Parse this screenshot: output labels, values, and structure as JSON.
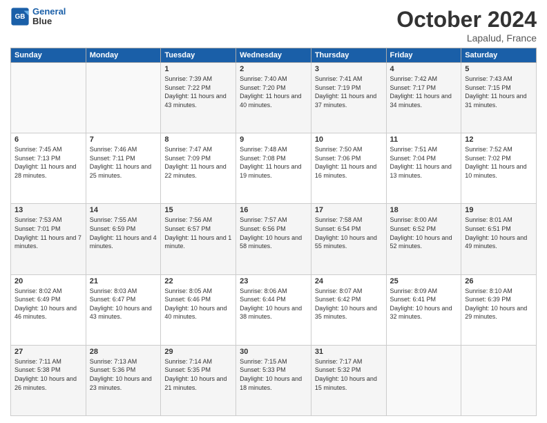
{
  "header": {
    "logo_line1": "General",
    "logo_line2": "Blue",
    "month": "October 2024",
    "location": "Lapalud, France"
  },
  "days_of_week": [
    "Sunday",
    "Monday",
    "Tuesday",
    "Wednesday",
    "Thursday",
    "Friday",
    "Saturday"
  ],
  "weeks": [
    [
      {
        "day": "",
        "sunrise": "",
        "sunset": "",
        "daylight": ""
      },
      {
        "day": "",
        "sunrise": "",
        "sunset": "",
        "daylight": ""
      },
      {
        "day": "1",
        "sunrise": "Sunrise: 7:39 AM",
        "sunset": "Sunset: 7:22 PM",
        "daylight": "Daylight: 11 hours and 43 minutes."
      },
      {
        "day": "2",
        "sunrise": "Sunrise: 7:40 AM",
        "sunset": "Sunset: 7:20 PM",
        "daylight": "Daylight: 11 hours and 40 minutes."
      },
      {
        "day": "3",
        "sunrise": "Sunrise: 7:41 AM",
        "sunset": "Sunset: 7:19 PM",
        "daylight": "Daylight: 11 hours and 37 minutes."
      },
      {
        "day": "4",
        "sunrise": "Sunrise: 7:42 AM",
        "sunset": "Sunset: 7:17 PM",
        "daylight": "Daylight: 11 hours and 34 minutes."
      },
      {
        "day": "5",
        "sunrise": "Sunrise: 7:43 AM",
        "sunset": "Sunset: 7:15 PM",
        "daylight": "Daylight: 11 hours and 31 minutes."
      }
    ],
    [
      {
        "day": "6",
        "sunrise": "Sunrise: 7:45 AM",
        "sunset": "Sunset: 7:13 PM",
        "daylight": "Daylight: 11 hours and 28 minutes."
      },
      {
        "day": "7",
        "sunrise": "Sunrise: 7:46 AM",
        "sunset": "Sunset: 7:11 PM",
        "daylight": "Daylight: 11 hours and 25 minutes."
      },
      {
        "day": "8",
        "sunrise": "Sunrise: 7:47 AM",
        "sunset": "Sunset: 7:09 PM",
        "daylight": "Daylight: 11 hours and 22 minutes."
      },
      {
        "day": "9",
        "sunrise": "Sunrise: 7:48 AM",
        "sunset": "Sunset: 7:08 PM",
        "daylight": "Daylight: 11 hours and 19 minutes."
      },
      {
        "day": "10",
        "sunrise": "Sunrise: 7:50 AM",
        "sunset": "Sunset: 7:06 PM",
        "daylight": "Daylight: 11 hours and 16 minutes."
      },
      {
        "day": "11",
        "sunrise": "Sunrise: 7:51 AM",
        "sunset": "Sunset: 7:04 PM",
        "daylight": "Daylight: 11 hours and 13 minutes."
      },
      {
        "day": "12",
        "sunrise": "Sunrise: 7:52 AM",
        "sunset": "Sunset: 7:02 PM",
        "daylight": "Daylight: 11 hours and 10 minutes."
      }
    ],
    [
      {
        "day": "13",
        "sunrise": "Sunrise: 7:53 AM",
        "sunset": "Sunset: 7:01 PM",
        "daylight": "Daylight: 11 hours and 7 minutes."
      },
      {
        "day": "14",
        "sunrise": "Sunrise: 7:55 AM",
        "sunset": "Sunset: 6:59 PM",
        "daylight": "Daylight: 11 hours and 4 minutes."
      },
      {
        "day": "15",
        "sunrise": "Sunrise: 7:56 AM",
        "sunset": "Sunset: 6:57 PM",
        "daylight": "Daylight: 11 hours and 1 minute."
      },
      {
        "day": "16",
        "sunrise": "Sunrise: 7:57 AM",
        "sunset": "Sunset: 6:56 PM",
        "daylight": "Daylight: 10 hours and 58 minutes."
      },
      {
        "day": "17",
        "sunrise": "Sunrise: 7:58 AM",
        "sunset": "Sunset: 6:54 PM",
        "daylight": "Daylight: 10 hours and 55 minutes."
      },
      {
        "day": "18",
        "sunrise": "Sunrise: 8:00 AM",
        "sunset": "Sunset: 6:52 PM",
        "daylight": "Daylight: 10 hours and 52 minutes."
      },
      {
        "day": "19",
        "sunrise": "Sunrise: 8:01 AM",
        "sunset": "Sunset: 6:51 PM",
        "daylight": "Daylight: 10 hours and 49 minutes."
      }
    ],
    [
      {
        "day": "20",
        "sunrise": "Sunrise: 8:02 AM",
        "sunset": "Sunset: 6:49 PM",
        "daylight": "Daylight: 10 hours and 46 minutes."
      },
      {
        "day": "21",
        "sunrise": "Sunrise: 8:03 AM",
        "sunset": "Sunset: 6:47 PM",
        "daylight": "Daylight: 10 hours and 43 minutes."
      },
      {
        "day": "22",
        "sunrise": "Sunrise: 8:05 AM",
        "sunset": "Sunset: 6:46 PM",
        "daylight": "Daylight: 10 hours and 40 minutes."
      },
      {
        "day": "23",
        "sunrise": "Sunrise: 8:06 AM",
        "sunset": "Sunset: 6:44 PM",
        "daylight": "Daylight: 10 hours and 38 minutes."
      },
      {
        "day": "24",
        "sunrise": "Sunrise: 8:07 AM",
        "sunset": "Sunset: 6:42 PM",
        "daylight": "Daylight: 10 hours and 35 minutes."
      },
      {
        "day": "25",
        "sunrise": "Sunrise: 8:09 AM",
        "sunset": "Sunset: 6:41 PM",
        "daylight": "Daylight: 10 hours and 32 minutes."
      },
      {
        "day": "26",
        "sunrise": "Sunrise: 8:10 AM",
        "sunset": "Sunset: 6:39 PM",
        "daylight": "Daylight: 10 hours and 29 minutes."
      }
    ],
    [
      {
        "day": "27",
        "sunrise": "Sunrise: 7:11 AM",
        "sunset": "Sunset: 5:38 PM",
        "daylight": "Daylight: 10 hours and 26 minutes."
      },
      {
        "day": "28",
        "sunrise": "Sunrise: 7:13 AM",
        "sunset": "Sunset: 5:36 PM",
        "daylight": "Daylight: 10 hours and 23 minutes."
      },
      {
        "day": "29",
        "sunrise": "Sunrise: 7:14 AM",
        "sunset": "Sunset: 5:35 PM",
        "daylight": "Daylight: 10 hours and 21 minutes."
      },
      {
        "day": "30",
        "sunrise": "Sunrise: 7:15 AM",
        "sunset": "Sunset: 5:33 PM",
        "daylight": "Daylight: 10 hours and 18 minutes."
      },
      {
        "day": "31",
        "sunrise": "Sunrise: 7:17 AM",
        "sunset": "Sunset: 5:32 PM",
        "daylight": "Daylight: 10 hours and 15 minutes."
      },
      {
        "day": "",
        "sunrise": "",
        "sunset": "",
        "daylight": ""
      },
      {
        "day": "",
        "sunrise": "",
        "sunset": "",
        "daylight": ""
      }
    ]
  ]
}
